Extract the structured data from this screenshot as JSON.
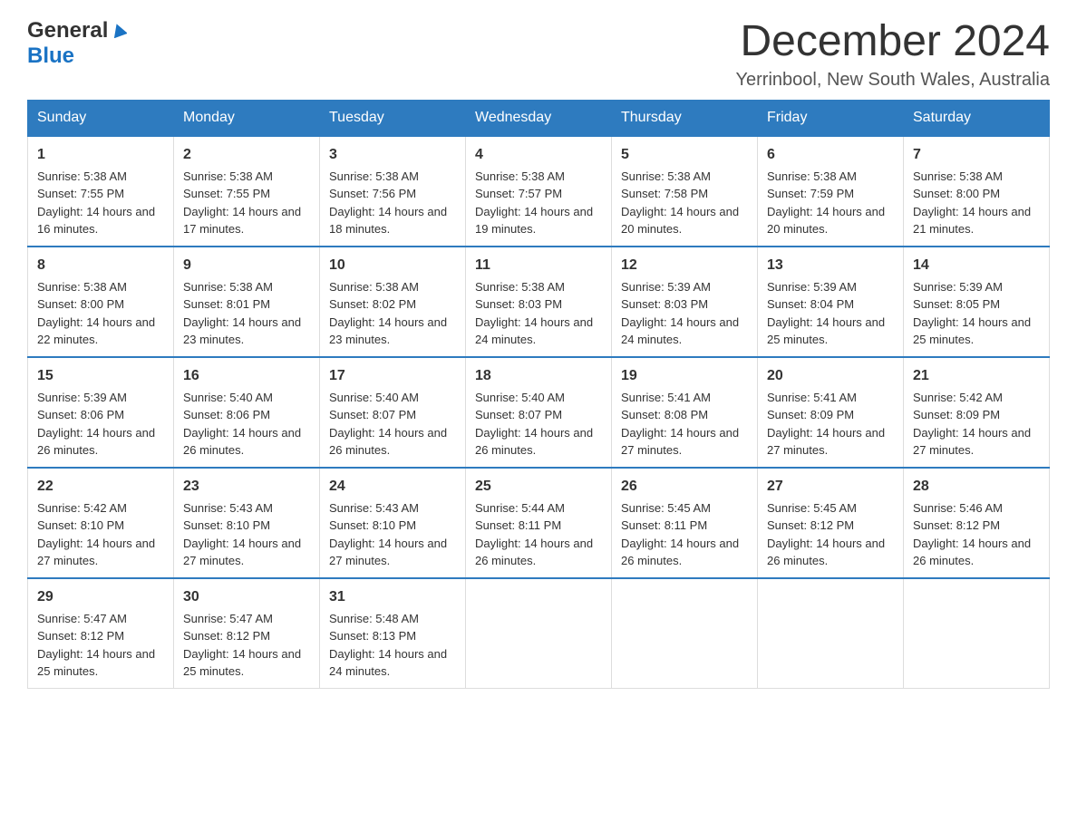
{
  "logo": {
    "general": "General",
    "blue": "Blue"
  },
  "header": {
    "month_year": "December 2024",
    "location": "Yerrinbool, New South Wales, Australia"
  },
  "weekdays": [
    "Sunday",
    "Monday",
    "Tuesday",
    "Wednesday",
    "Thursday",
    "Friday",
    "Saturday"
  ],
  "weeks": [
    [
      {
        "day": "1",
        "sunrise": "5:38 AM",
        "sunset": "7:55 PM",
        "daylight": "14 hours and 16 minutes."
      },
      {
        "day": "2",
        "sunrise": "5:38 AM",
        "sunset": "7:55 PM",
        "daylight": "14 hours and 17 minutes."
      },
      {
        "day": "3",
        "sunrise": "5:38 AM",
        "sunset": "7:56 PM",
        "daylight": "14 hours and 18 minutes."
      },
      {
        "day": "4",
        "sunrise": "5:38 AM",
        "sunset": "7:57 PM",
        "daylight": "14 hours and 19 minutes."
      },
      {
        "day": "5",
        "sunrise": "5:38 AM",
        "sunset": "7:58 PM",
        "daylight": "14 hours and 20 minutes."
      },
      {
        "day": "6",
        "sunrise": "5:38 AM",
        "sunset": "7:59 PM",
        "daylight": "14 hours and 20 minutes."
      },
      {
        "day": "7",
        "sunrise": "5:38 AM",
        "sunset": "8:00 PM",
        "daylight": "14 hours and 21 minutes."
      }
    ],
    [
      {
        "day": "8",
        "sunrise": "5:38 AM",
        "sunset": "8:00 PM",
        "daylight": "14 hours and 22 minutes."
      },
      {
        "day": "9",
        "sunrise": "5:38 AM",
        "sunset": "8:01 PM",
        "daylight": "14 hours and 23 minutes."
      },
      {
        "day": "10",
        "sunrise": "5:38 AM",
        "sunset": "8:02 PM",
        "daylight": "14 hours and 23 minutes."
      },
      {
        "day": "11",
        "sunrise": "5:38 AM",
        "sunset": "8:03 PM",
        "daylight": "14 hours and 24 minutes."
      },
      {
        "day": "12",
        "sunrise": "5:39 AM",
        "sunset": "8:03 PM",
        "daylight": "14 hours and 24 minutes."
      },
      {
        "day": "13",
        "sunrise": "5:39 AM",
        "sunset": "8:04 PM",
        "daylight": "14 hours and 25 minutes."
      },
      {
        "day": "14",
        "sunrise": "5:39 AM",
        "sunset": "8:05 PM",
        "daylight": "14 hours and 25 minutes."
      }
    ],
    [
      {
        "day": "15",
        "sunrise": "5:39 AM",
        "sunset": "8:06 PM",
        "daylight": "14 hours and 26 minutes."
      },
      {
        "day": "16",
        "sunrise": "5:40 AM",
        "sunset": "8:06 PM",
        "daylight": "14 hours and 26 minutes."
      },
      {
        "day": "17",
        "sunrise": "5:40 AM",
        "sunset": "8:07 PM",
        "daylight": "14 hours and 26 minutes."
      },
      {
        "day": "18",
        "sunrise": "5:40 AM",
        "sunset": "8:07 PM",
        "daylight": "14 hours and 26 minutes."
      },
      {
        "day": "19",
        "sunrise": "5:41 AM",
        "sunset": "8:08 PM",
        "daylight": "14 hours and 27 minutes."
      },
      {
        "day": "20",
        "sunrise": "5:41 AM",
        "sunset": "8:09 PM",
        "daylight": "14 hours and 27 minutes."
      },
      {
        "day": "21",
        "sunrise": "5:42 AM",
        "sunset": "8:09 PM",
        "daylight": "14 hours and 27 minutes."
      }
    ],
    [
      {
        "day": "22",
        "sunrise": "5:42 AM",
        "sunset": "8:10 PM",
        "daylight": "14 hours and 27 minutes."
      },
      {
        "day": "23",
        "sunrise": "5:43 AM",
        "sunset": "8:10 PM",
        "daylight": "14 hours and 27 minutes."
      },
      {
        "day": "24",
        "sunrise": "5:43 AM",
        "sunset": "8:10 PM",
        "daylight": "14 hours and 27 minutes."
      },
      {
        "day": "25",
        "sunrise": "5:44 AM",
        "sunset": "8:11 PM",
        "daylight": "14 hours and 26 minutes."
      },
      {
        "day": "26",
        "sunrise": "5:45 AM",
        "sunset": "8:11 PM",
        "daylight": "14 hours and 26 minutes."
      },
      {
        "day": "27",
        "sunrise": "5:45 AM",
        "sunset": "8:12 PM",
        "daylight": "14 hours and 26 minutes."
      },
      {
        "day": "28",
        "sunrise": "5:46 AM",
        "sunset": "8:12 PM",
        "daylight": "14 hours and 26 minutes."
      }
    ],
    [
      {
        "day": "29",
        "sunrise": "5:47 AM",
        "sunset": "8:12 PM",
        "daylight": "14 hours and 25 minutes."
      },
      {
        "day": "30",
        "sunrise": "5:47 AM",
        "sunset": "8:12 PM",
        "daylight": "14 hours and 25 minutes."
      },
      {
        "day": "31",
        "sunrise": "5:48 AM",
        "sunset": "8:13 PM",
        "daylight": "14 hours and 24 minutes."
      },
      null,
      null,
      null,
      null
    ]
  ],
  "labels": {
    "sunrise": "Sunrise:",
    "sunset": "Sunset:",
    "daylight": "Daylight:"
  }
}
